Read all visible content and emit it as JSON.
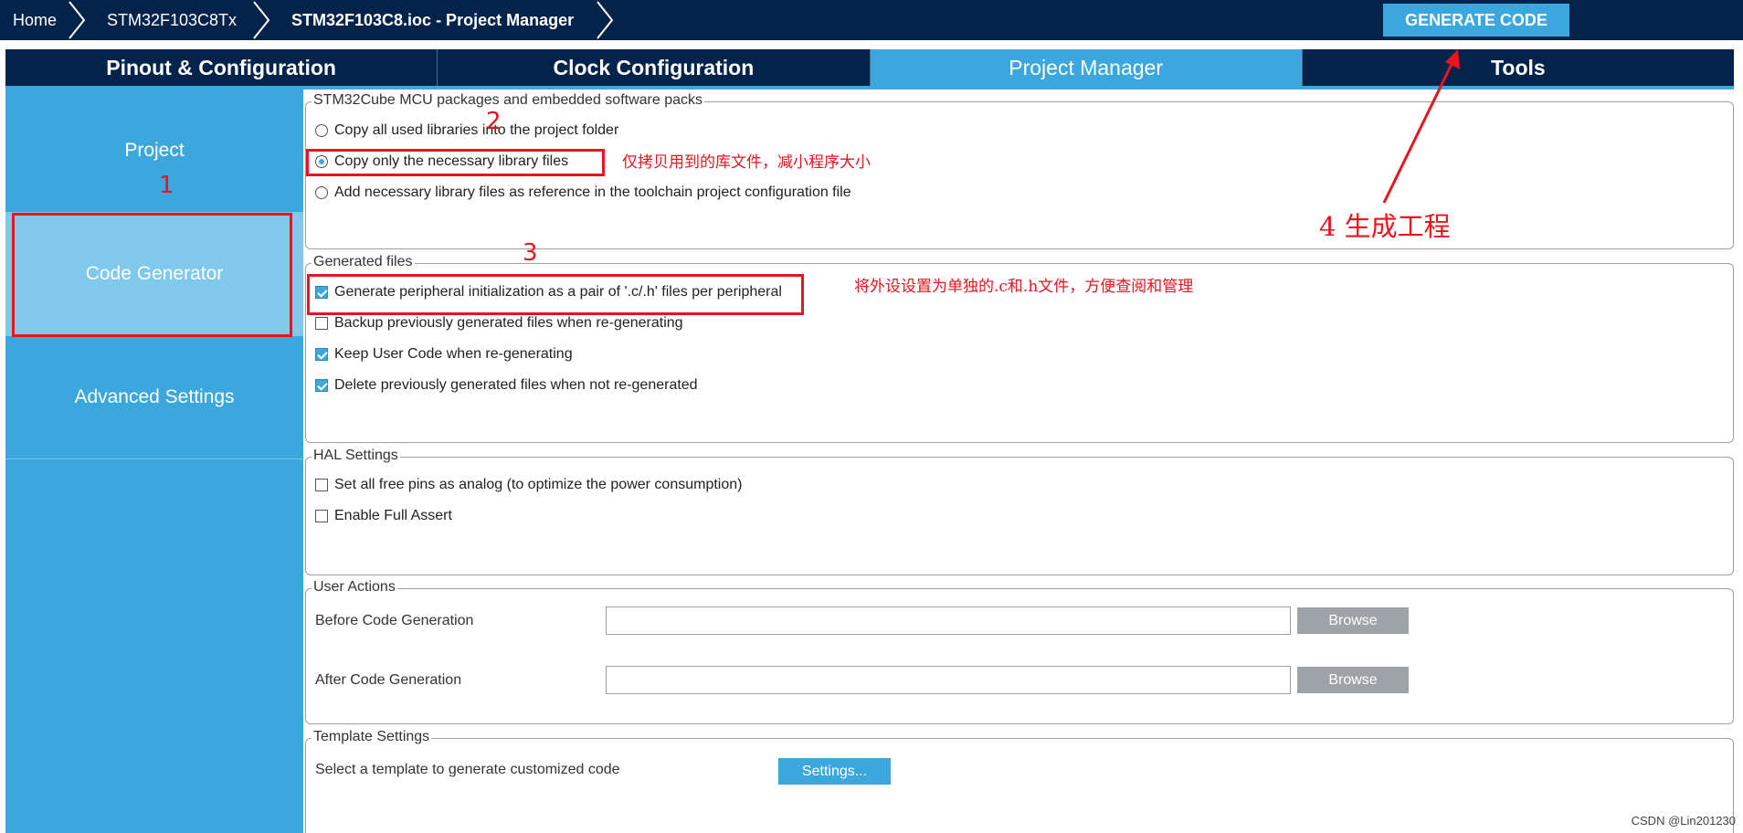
{
  "breadcrumbs": [
    "Home",
    "STM32F103C8Tx",
    "STM32F103C8.ioc - Project Manager"
  ],
  "generate_button": "GENERATE CODE",
  "tabs": [
    "Pinout & Configuration",
    "Clock Configuration",
    "Project Manager",
    "Tools"
  ],
  "active_tab": "Project Manager",
  "sidebar": {
    "items": [
      "Project",
      "Code Generator",
      "Advanced Settings"
    ],
    "active": "Code Generator"
  },
  "packages": {
    "title": "STM32Cube MCU packages and embedded software packs",
    "options": [
      "Copy all used libraries into the project folder",
      "Copy only the necessary library files",
      "Add necessary library files as reference in the toolchain project configuration file"
    ],
    "selected": "Copy only the necessary library files"
  },
  "generated_files": {
    "title": "Generated files",
    "options": [
      {
        "label": "Generate peripheral initialization as a pair of '.c/.h' files per peripheral",
        "checked": true
      },
      {
        "label": "Backup previously generated files when re-generating",
        "checked": false
      },
      {
        "label": "Keep User Code when re-generating",
        "checked": true
      },
      {
        "label": "Delete previously generated files when not re-generated",
        "checked": true
      }
    ]
  },
  "hal_settings": {
    "title": "HAL Settings",
    "options": [
      {
        "label": "Set all free pins as analog (to optimize the power consumption)",
        "checked": false
      },
      {
        "label": "Enable Full Assert",
        "checked": false
      }
    ]
  },
  "user_actions": {
    "title": "User Actions",
    "before_label": "Before Code Generation",
    "before_value": "",
    "after_label": "After Code Generation",
    "after_value": "",
    "browse_label": "Browse"
  },
  "template_settings": {
    "title": "Template Settings",
    "label": "Select a template to generate customized code",
    "button": "Settings..."
  },
  "annotations": {
    "n1": "1",
    "n2": "2",
    "n3": "3",
    "note2": "仅拷贝用到的库文件，减小程序大小",
    "note3": "将外设设置为单独的.c和.h文件，方便查阅和管理",
    "note4": "4 生成工程"
  },
  "watermark": "CSDN @Lin201230",
  "colors": {
    "navy": "#03234b",
    "accent": "#3ca7dc",
    "sidebar_active": "#80c8ec",
    "annotation_red": "#e8141e",
    "browse_gray": "#9ea3a8"
  }
}
